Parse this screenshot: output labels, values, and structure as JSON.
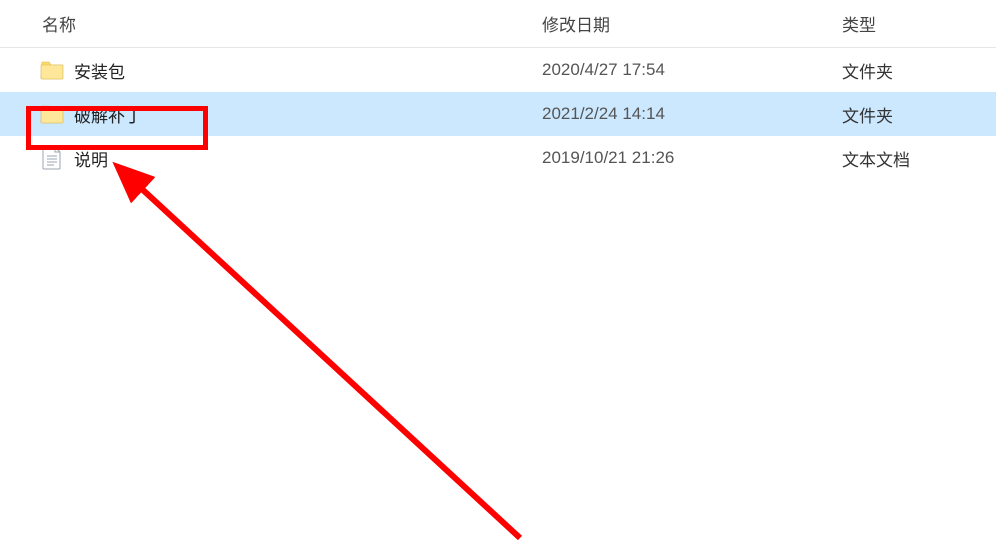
{
  "header": {
    "name_label": "名称",
    "date_label": "修改日期",
    "type_label": "类型",
    "sort_glyph": "^"
  },
  "rows": [
    {
      "icon": "folder",
      "name": "安装包",
      "date": "2020/4/27 17:54",
      "type": "文件夹",
      "selected": false
    },
    {
      "icon": "folder",
      "name": "破解补丁",
      "date": "2021/2/24 14:14",
      "type": "文件夹",
      "selected": true
    },
    {
      "icon": "document",
      "name": "说明",
      "date": "2019/10/21 21:26",
      "type": "文本文档",
      "selected": false
    }
  ]
}
